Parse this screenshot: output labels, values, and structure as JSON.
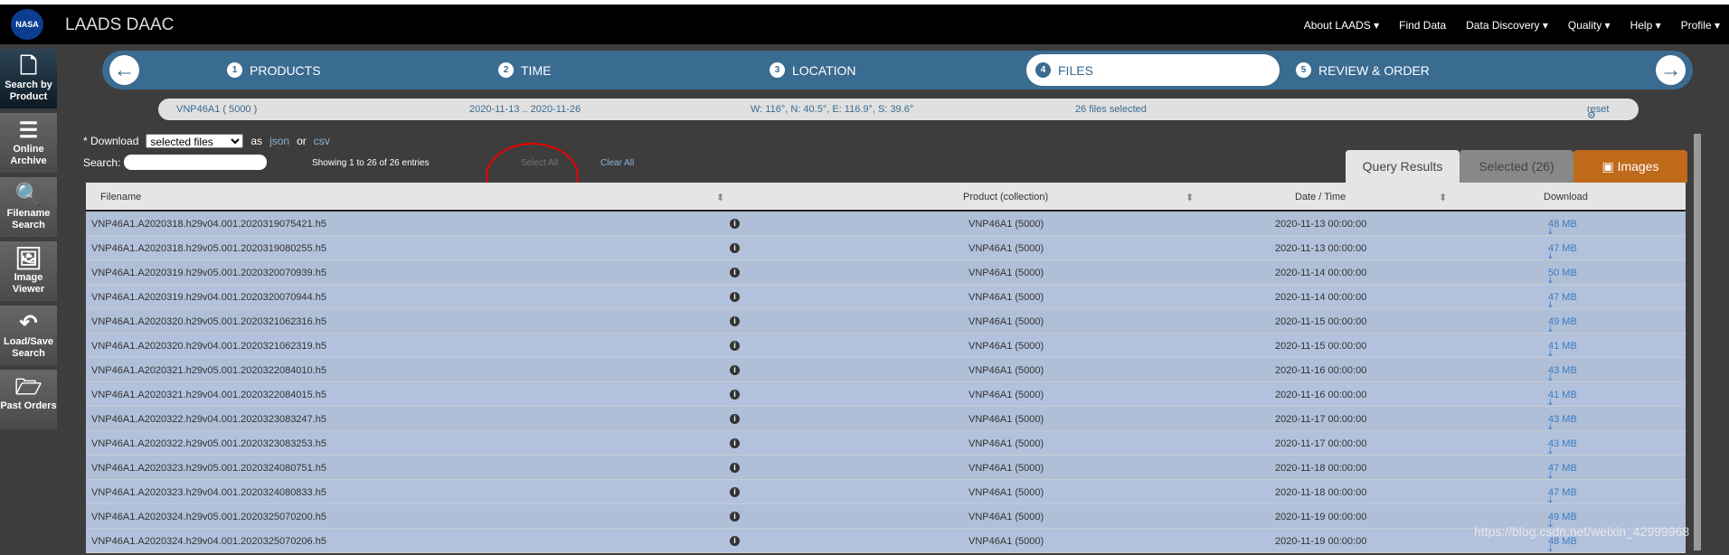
{
  "header": {
    "logo": "NASA",
    "brand": "LAADS DAAC",
    "nav": [
      "About LAADS ▾",
      "Find Data",
      "Data Discovery ▾",
      "Quality ▾",
      "Help ▾",
      "Profile ▾"
    ]
  },
  "sidebar": [
    {
      "label": "Search by Product",
      "icon": "file-icon",
      "glyph": "🗋"
    },
    {
      "label": "Online Archive",
      "icon": "list-ol-icon",
      "glyph": "☰"
    },
    {
      "label": "Filename Search",
      "icon": "search-icon",
      "glyph": "🔍"
    },
    {
      "label": "Image Viewer",
      "icon": "image-icon",
      "glyph": "🖼"
    },
    {
      "label": "Load/Save Search",
      "icon": "reply-icon",
      "glyph": "↶"
    },
    {
      "label": "Past Orders",
      "icon": "folder-open-icon",
      "glyph": "🗁"
    }
  ],
  "wizard": {
    "back": "←",
    "forward": "→",
    "steps": [
      {
        "n": "1",
        "label": "PRODUCTS"
      },
      {
        "n": "2",
        "label": "TIME"
      },
      {
        "n": "3",
        "label": "LOCATION"
      },
      {
        "n": "4",
        "label": "FILES"
      },
      {
        "n": "5",
        "label": "REVIEW & ORDER"
      }
    ]
  },
  "summary": {
    "product": "VNP46A1 ( 5000 )",
    "time": "2020-11-13 .. 2020-11-26",
    "location": "W: 116°, N: 40.5°, E: 116.9°, S: 39.6°",
    "files": "26 files selected",
    "reset": "reset"
  },
  "download": {
    "label": "* Download",
    "select": "selected files",
    "as": "as",
    "json": "json",
    "or": "or",
    "csv": "csv"
  },
  "search": {
    "label": "Search:",
    "value": ""
  },
  "showing": "Showing 1 to 26 of 26 entries",
  "select_all": "Select All",
  "clear_all": "Clear All",
  "tabs": [
    "Query Results",
    "Selected (26)",
    "Images"
  ],
  "columns": [
    "Filename",
    "Product (collection)",
    "Date / Time",
    "Download"
  ],
  "rows": [
    [
      "VNP46A1.A2020318.h29v04.001.2020319075421.h5",
      "VNP46A1 (5000)",
      "2020-11-13 00:00:00",
      "48 MB"
    ],
    [
      "VNP46A1.A2020318.h29v05.001.2020319080255.h5",
      "VNP46A1 (5000)",
      "2020-11-13 00:00:00",
      "47 MB"
    ],
    [
      "VNP46A1.A2020319.h29v05.001.2020320070939.h5",
      "VNP46A1 (5000)",
      "2020-11-14 00:00:00",
      "50 MB"
    ],
    [
      "VNP46A1.A2020319.h29v04.001.2020320070944.h5",
      "VNP46A1 (5000)",
      "2020-11-14 00:00:00",
      "47 MB"
    ],
    [
      "VNP46A1.A2020320.h29v05.001.2020321062316.h5",
      "VNP46A1 (5000)",
      "2020-11-15 00:00:00",
      "49 MB"
    ],
    [
      "VNP46A1.A2020320.h29v04.001.2020321062319.h5",
      "VNP46A1 (5000)",
      "2020-11-15 00:00:00",
      "41 MB"
    ],
    [
      "VNP46A1.A2020321.h29v05.001.2020322084010.h5",
      "VNP46A1 (5000)",
      "2020-11-16 00:00:00",
      "43 MB"
    ],
    [
      "VNP46A1.A2020321.h29v04.001.2020322084015.h5",
      "VNP46A1 (5000)",
      "2020-11-16 00:00:00",
      "41 MB"
    ],
    [
      "VNP46A1.A2020322.h29v04.001.2020323083247.h5",
      "VNP46A1 (5000)",
      "2020-11-17 00:00:00",
      "43 MB"
    ],
    [
      "VNP46A1.A2020322.h29v05.001.2020323083253.h5",
      "VNP46A1 (5000)",
      "2020-11-17 00:00:00",
      "43 MB"
    ],
    [
      "VNP46A1.A2020323.h29v05.001.2020324080751.h5",
      "VNP46A1 (5000)",
      "2020-11-18 00:00:00",
      "47 MB"
    ],
    [
      "VNP46A1.A2020323.h29v04.001.2020324080833.h5",
      "VNP46A1 (5000)",
      "2020-11-18 00:00:00",
      "47 MB"
    ],
    [
      "VNP46A1.A2020324.h29v05.001.2020325070200.h5",
      "VNP46A1 (5000)",
      "2020-11-19 00:00:00",
      "49 MB"
    ],
    [
      "VNP46A1.A2020324.h29v04.001.2020325070206.h5",
      "VNP46A1 (5000)",
      "2020-11-19 00:00:00",
      "48 MB"
    ]
  ],
  "watermark": "https://blog.csdn.net/weixin_42999968",
  "colors": {
    "wizard": "#3a6b91",
    "images_tab": "#c06a1b",
    "row": "#afbfd8",
    "annotation": "#e00000"
  }
}
